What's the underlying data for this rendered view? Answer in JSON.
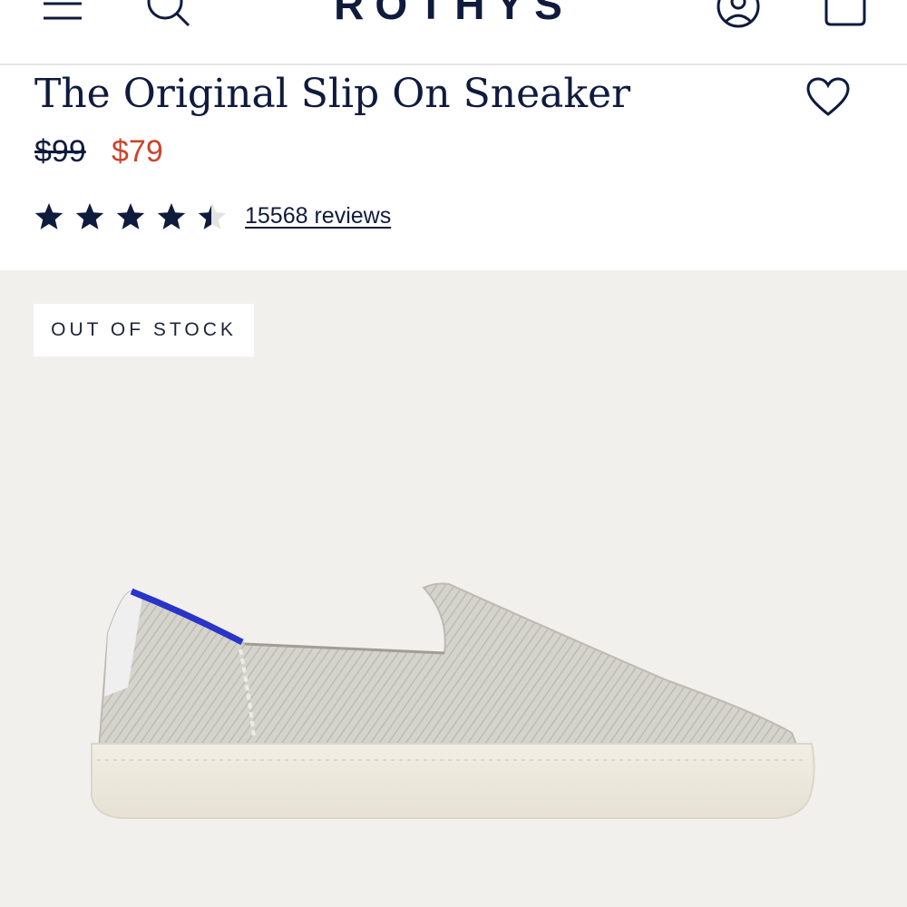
{
  "header": {
    "logo": "ROTHYS",
    "menu_icon": "menu-icon",
    "search_icon": "search-icon",
    "account_icon": "account-icon",
    "bag_icon": "bag-icon"
  },
  "product": {
    "title": "The Original Slip On Sneaker",
    "price_original": "$99",
    "price_sale": "$79",
    "rating": 4.5,
    "rating_max": 5,
    "reviews_label": "15568 reviews",
    "favorite_icon": "heart-icon"
  },
  "gallery": {
    "badge": "OUT OF STOCK",
    "image": "grey knit slip-on sneaker with blue heel tab and cream sole"
  },
  "colors": {
    "navy": "#0f1b3d",
    "sale_red": "#c9452d",
    "gallery_bg": "#f1f0ed",
    "heel_blue": "#2a34c8"
  }
}
